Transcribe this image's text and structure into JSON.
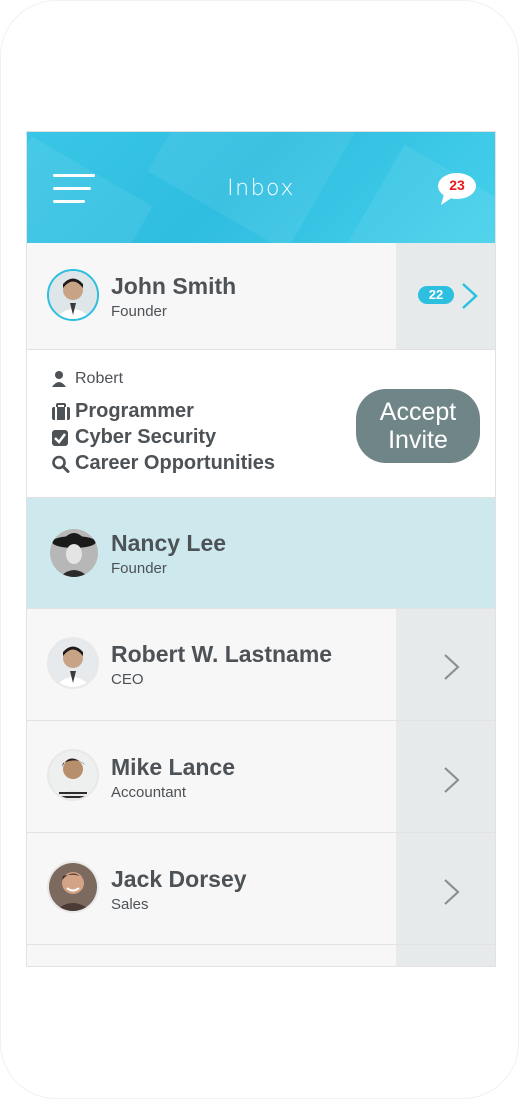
{
  "header": {
    "title": "Inbox",
    "message_count": "23"
  },
  "contacts": [
    {
      "name": "John Smith",
      "role": "Founder",
      "badge": "22"
    },
    {
      "name": "Nancy Lee",
      "role": "Founder"
    },
    {
      "name": "Robert W. Lastname",
      "role": "CEO"
    },
    {
      "name": "Mike Lance",
      "role": "Accountant"
    },
    {
      "name": "Jack Dorsey",
      "role": "Sales"
    }
  ],
  "invite": {
    "sender": "Robert",
    "skills": [
      "Programmer",
      "Cyber Security",
      "Career Opportunities"
    ],
    "accept_line1": "Accept",
    "accept_line2": "Invite"
  },
  "colors": {
    "accent": "#2cbfe0",
    "badge_text": "#e8181b",
    "accept_button": "#6f8587",
    "highlight_row": "#cde9ee"
  },
  "icons": {
    "menu": "hamburger-icon",
    "messages": "chat-bubble-icon",
    "sender": "user-icon",
    "skill_1": "briefcase-icon",
    "skill_2": "checkbox-icon",
    "skill_3": "search-icon",
    "row_action": "chevron-right-icon"
  }
}
